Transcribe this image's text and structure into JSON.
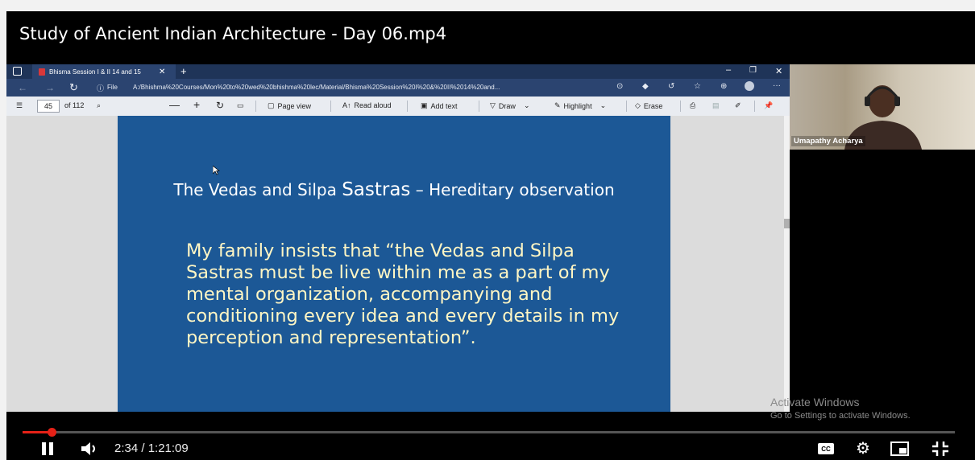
{
  "video": {
    "title": "Study of Ancient Indian Architecture - Day 06.mp4",
    "progress_fraction": 0.0315,
    "time_display": "2:34 / 1:21:09"
  },
  "browser": {
    "tab_title": "Bhisma Session I & II 14 and 15",
    "url_label": "File",
    "url": "A:/Bhishma%20Courses/Mon%20to%20wed%20bhishma%20lec/Material/Bhisma%20Session%20I%20&%20II%2014%20and...",
    "new_tab": "+"
  },
  "pdf_toolbar": {
    "page_number": "45",
    "page_total": "of 112",
    "page_view": "Page view",
    "read_aloud": "Read aloud",
    "add_text": "Add text",
    "draw": "Draw",
    "highlight": "Highlight",
    "erase": "Erase"
  },
  "slide": {
    "heading_part1": "The Vedas and Silpa ",
    "heading_part2": "Sastras",
    "heading_part3": " – Hereditary observation",
    "body": "My family insists that “the Vedas and Silpa Sastras must be live within me as a part of my mental organization, accompanying and conditioning every idea and every details in my perception and representation”."
  },
  "camera": {
    "participant_name": "Umapathy Acharya"
  },
  "watermark": {
    "line1": "Activate Windows",
    "line2": "Go to Settings to activate Windows."
  },
  "colors": {
    "slide_bg": "#1c5896",
    "slide_body_text": "#fff6c4",
    "progress": "#e62117"
  }
}
